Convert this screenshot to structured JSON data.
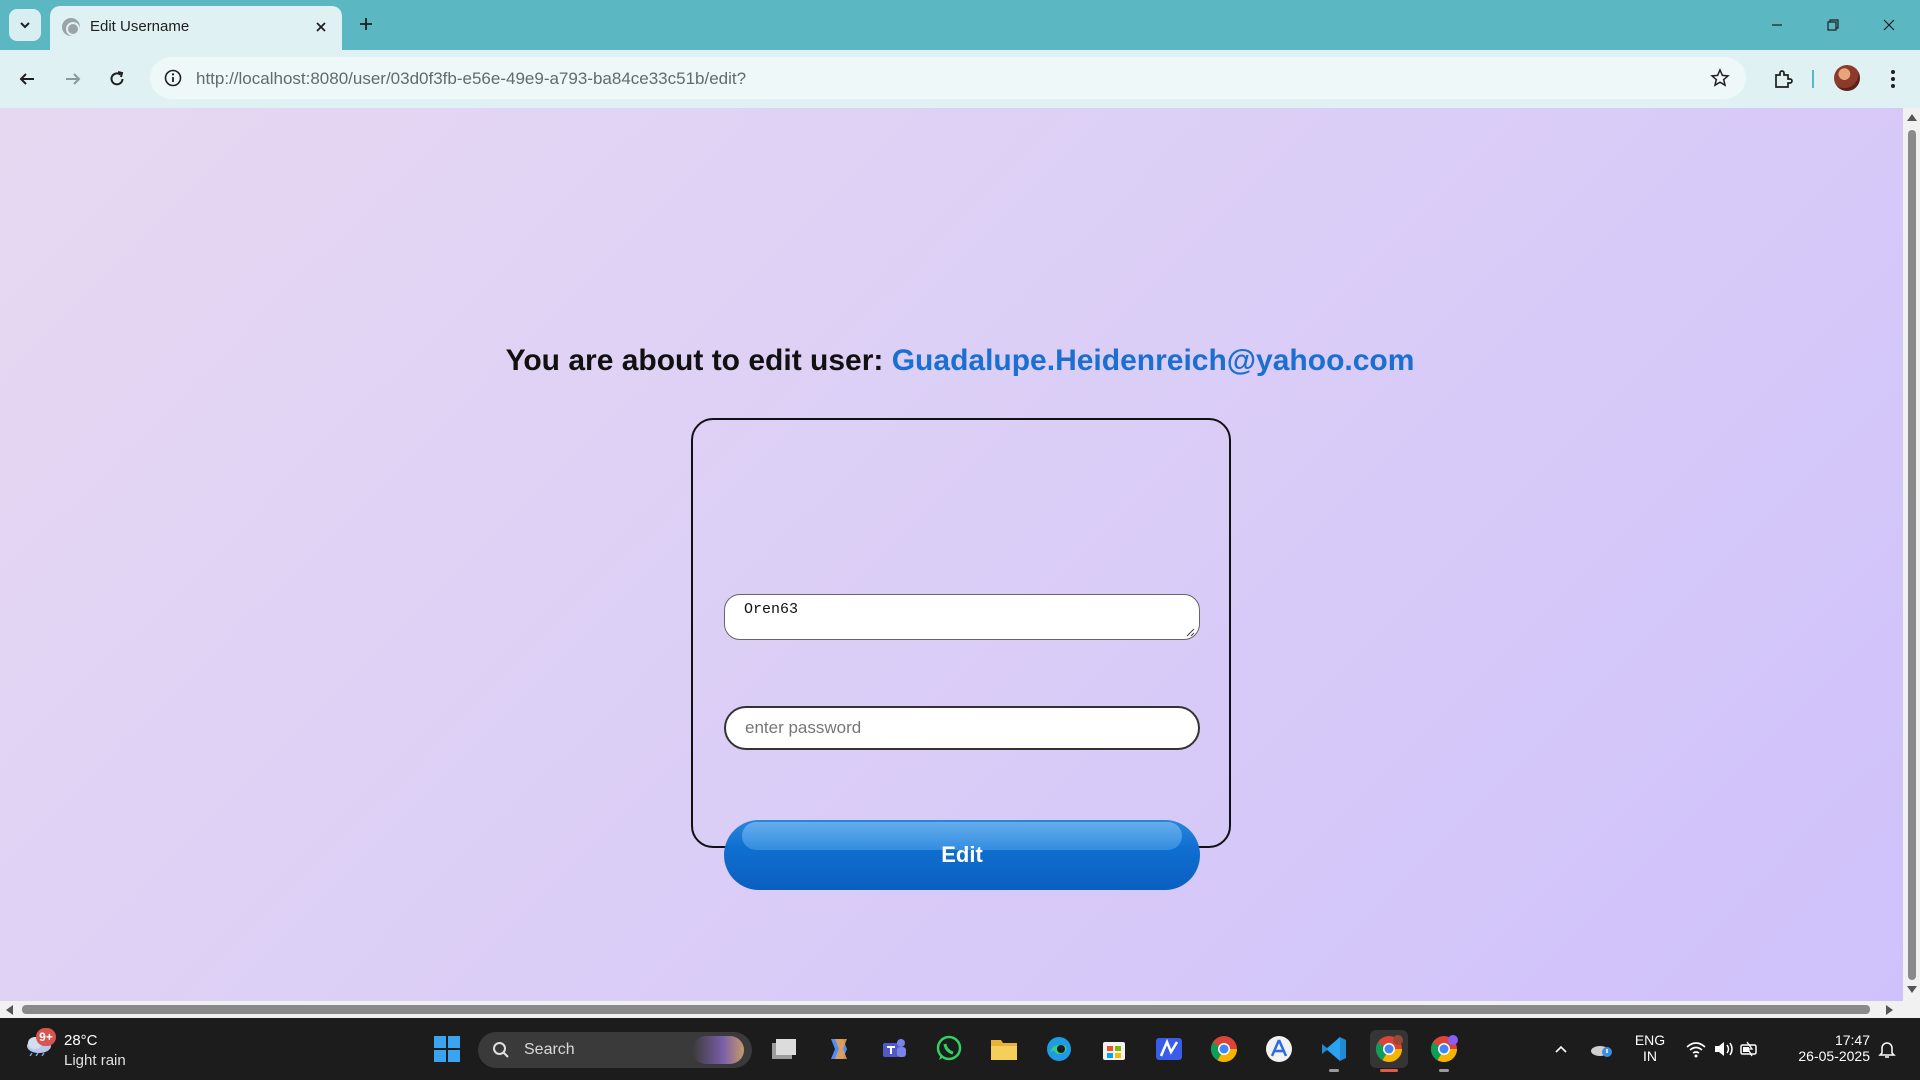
{
  "browser": {
    "tab_title": "Edit Username",
    "url_host": "http://localhost",
    "url_path": ":8080/user/03d0f3fb-e56e-49e9-a793-ba84ce33c51b/edit?"
  },
  "page": {
    "heading_prefix": "You are about to edit user: ",
    "heading_email": "Guadalupe.Heidenreich@yahoo.com",
    "username_value": "Oren63",
    "password_placeholder": "enter password",
    "edit_button_label": "Edit"
  },
  "taskbar": {
    "weather_badge": "9+",
    "weather_temp": "28°C",
    "weather_desc": "Light rain",
    "search_label": "Search",
    "language_top": "ENG",
    "language_bottom": "IN",
    "time": "17:47",
    "date": "26-05-2025",
    "pinned_apps": [
      "start-icon",
      "search",
      "task-view-icon",
      "copilot-icon",
      "teams-icon",
      "whatsapp-icon",
      "file-explorer-icon",
      "edge-icon",
      "store-icon",
      "notes-icon",
      "chrome-icon",
      "app-icon",
      "vscode-icon",
      "chrome-active-icon",
      "chrome-profile-icon"
    ]
  },
  "colors": {
    "accent_blue": "#1b6fd1",
    "chrome_teal": "#5bb8c2",
    "page_bg_start": "#e7d8f1",
    "page_bg_end": "#cfc1fb"
  }
}
